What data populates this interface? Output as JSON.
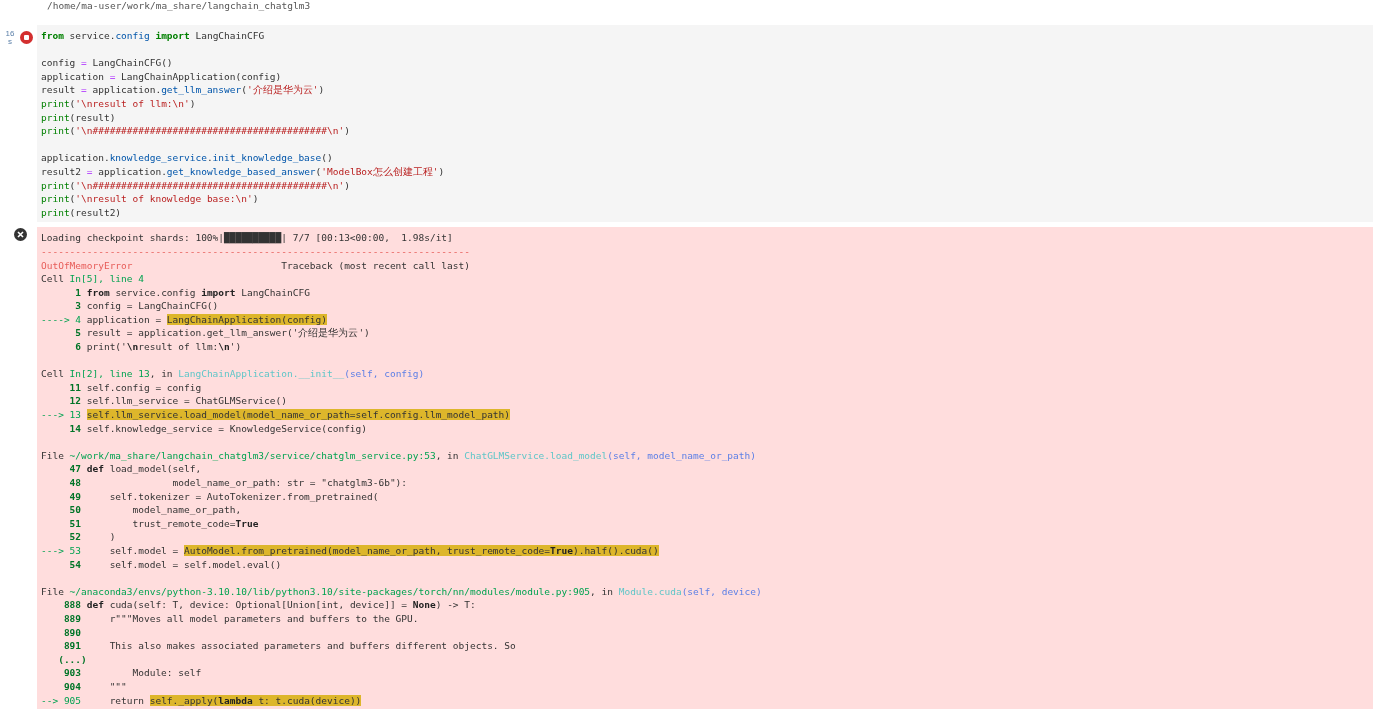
{
  "working_dir": "/home/ma-user/work/ma_share/langchain_chatglm3",
  "cell": {
    "exec_time": {
      "value": "16",
      "unit": "s"
    },
    "running": true,
    "code_blocks": [
      [
        [
          {
            "text": "from",
            "kind": "kw"
          },
          {
            "text": " service.",
            "kind": "p"
          },
          {
            "text": "config",
            "kind": "a"
          },
          {
            "text": " import",
            "kind": "kw"
          },
          {
            "text": " LangChainCFG",
            "kind": "p"
          }
        ]
      ],
      [
        [
          {
            "text": "config ",
            "kind": "p"
          },
          {
            "text": "=",
            "kind": "o"
          },
          {
            "text": " LangChainCFG()",
            "kind": "p"
          }
        ],
        [
          {
            "text": "application ",
            "kind": "p"
          },
          {
            "text": "=",
            "kind": "o"
          },
          {
            "text": " LangChainApplication(config)",
            "kind": "p"
          }
        ],
        [
          {
            "text": "result ",
            "kind": "p"
          },
          {
            "text": "=",
            "kind": "o"
          },
          {
            "text": " application.",
            "kind": "p"
          },
          {
            "text": "get_llm_answer",
            "kind": "a"
          },
          {
            "text": "(",
            "kind": "p"
          },
          {
            "text": "'介绍是华为云'",
            "kind": "s"
          },
          {
            "text": ")",
            "kind": "p"
          }
        ],
        [
          {
            "text": "print",
            "kind": "bi"
          },
          {
            "text": "(",
            "kind": "p"
          },
          {
            "text": "'\\nresult of llm:\\n'",
            "kind": "s"
          },
          {
            "text": ")",
            "kind": "p"
          }
        ],
        [
          {
            "text": "print",
            "kind": "bi"
          },
          {
            "text": "(result)",
            "kind": "p"
          }
        ],
        [
          {
            "text": "print",
            "kind": "bi"
          },
          {
            "text": "(",
            "kind": "p"
          },
          {
            "text": "'\\n#########################################\\n'",
            "kind": "s"
          },
          {
            "text": ")",
            "kind": "p"
          }
        ]
      ],
      [
        [
          {
            "text": "application.",
            "kind": "p"
          },
          {
            "text": "knowledge_service",
            "kind": "a"
          },
          {
            "text": ".",
            "kind": "p"
          },
          {
            "text": "init_knowledge_base",
            "kind": "a"
          },
          {
            "text": "()",
            "kind": "p"
          }
        ],
        [
          {
            "text": "result2 ",
            "kind": "p"
          },
          {
            "text": "=",
            "kind": "o"
          },
          {
            "text": " application.",
            "kind": "p"
          },
          {
            "text": "get_knowledge_based_answer",
            "kind": "a"
          },
          {
            "text": "(",
            "kind": "p"
          },
          {
            "text": "'ModelBox怎么创建工程'",
            "kind": "s"
          },
          {
            "text": ")",
            "kind": "p"
          }
        ],
        [
          {
            "text": "print",
            "kind": "bi"
          },
          {
            "text": "(",
            "kind": "p"
          },
          {
            "text": "'\\n#########################################\\n'",
            "kind": "s"
          },
          {
            "text": ")",
            "kind": "p"
          }
        ],
        [
          {
            "text": "print",
            "kind": "bi"
          },
          {
            "text": "(",
            "kind": "p"
          },
          {
            "text": "'\\nresult of knowledge base:\\n'",
            "kind": "s"
          },
          {
            "text": ")",
            "kind": "p"
          }
        ],
        [
          {
            "text": "print",
            "kind": "bi"
          },
          {
            "text": "(result2)",
            "kind": "p"
          }
        ]
      ]
    ]
  },
  "output": {
    "kind": "error",
    "blocks": [
      [
        [
          {
            "text": "Loading checkpoint shards: 100%|██████████| 7/7 [00:13<00:00,  1.98s/it]",
            "kind": "p"
          }
        ],
        [
          {
            "text": "---------------------------------------------------------------------------",
            "kind": "err"
          }
        ],
        [
          {
            "text": "OutOfMemoryError",
            "kind": "err"
          },
          {
            "text": "                          Traceback (most recent call last)",
            "kind": "p"
          }
        ],
        [
          {
            "text": "Cell ",
            "kind": "p"
          },
          {
            "text": "In[5], line 4",
            "kind": "g"
          }
        ],
        [
          {
            "text": "      1 ",
            "kind": "n"
          },
          {
            "text": "from",
            "kind": "kb"
          },
          {
            "text": " service.config ",
            "kind": "p"
          },
          {
            "text": "import",
            "kind": "kb"
          },
          {
            "text": " LangChainCFG",
            "kind": "p"
          }
        ],
        [
          {
            "text": "      3 ",
            "kind": "n"
          },
          {
            "text": "config = LangChainCFG()",
            "kind": "p"
          }
        ],
        [
          {
            "text": "----> 4 ",
            "kind": "ar"
          },
          {
            "text": "application = ",
            "kind": "p"
          },
          {
            "text": "LangChainApplication(config)",
            "kind": "h"
          }
        ],
        [
          {
            "text": "      5 ",
            "kind": "n"
          },
          {
            "text": "result = application.get_llm_answer('介绍是华为云')",
            "kind": "p"
          }
        ],
        [
          {
            "text": "      6 ",
            "kind": "n"
          },
          {
            "text": "print('",
            "kind": "p"
          },
          {
            "text": "\\n",
            "kind": "kb"
          },
          {
            "text": "result of llm:",
            "kind": "p"
          },
          {
            "text": "\\n",
            "kind": "kb"
          },
          {
            "text": "')",
            "kind": "p"
          }
        ]
      ],
      [
        [
          {
            "text": "Cell ",
            "kind": "p"
          },
          {
            "text": "In[2], line 13",
            "kind": "g"
          },
          {
            "text": ", in ",
            "kind": "p"
          },
          {
            "text": "LangChainApplication.__init__",
            "kind": "c"
          },
          {
            "text": "(self, config)",
            "kind": "b"
          }
        ],
        [
          {
            "text": "     11 ",
            "kind": "n"
          },
          {
            "text": "self.config = config",
            "kind": "p"
          }
        ],
        [
          {
            "text": "     12 ",
            "kind": "n"
          },
          {
            "text": "self.llm_service = ChatGLMService()",
            "kind": "p"
          }
        ],
        [
          {
            "text": "---> 13 ",
            "kind": "ar"
          },
          {
            "text": "self.llm_service.load_model(model_name_or_path=self.config.llm_model_path)",
            "kind": "h"
          }
        ],
        [
          {
            "text": "     14 ",
            "kind": "n"
          },
          {
            "text": "self.knowledge_service = KnowledgeService(config)",
            "kind": "p"
          }
        ]
      ],
      [
        [
          {
            "text": "File ",
            "kind": "p"
          },
          {
            "text": "~/work/ma_share/langchain_chatglm3/service/chatglm_service.py:53",
            "kind": "g"
          },
          {
            "text": ", in ",
            "kind": "p"
          },
          {
            "text": "ChatGLMService.load_model",
            "kind": "c"
          },
          {
            "text": "(self, model_name_or_path)",
            "kind": "b"
          }
        ],
        [
          {
            "text": "     47 ",
            "kind": "n"
          },
          {
            "text": "def",
            "kind": "kb"
          },
          {
            "text": " load_model(self,",
            "kind": "p"
          }
        ],
        [
          {
            "text": "     48 ",
            "kind": "n"
          },
          {
            "text": "               model_name_or_path: str = \"chatglm3-6b\"):",
            "kind": "p"
          }
        ],
        [
          {
            "text": "     49 ",
            "kind": "n"
          },
          {
            "text": "    self.tokenizer = AutoTokenizer.from_pretrained(",
            "kind": "p"
          }
        ],
        [
          {
            "text": "     50 ",
            "kind": "n"
          },
          {
            "text": "        model_name_or_path,",
            "kind": "p"
          }
        ],
        [
          {
            "text": "     51 ",
            "kind": "n"
          },
          {
            "text": "        trust_remote_code=",
            "kind": "p"
          },
          {
            "text": "True",
            "kind": "kb"
          }
        ],
        [
          {
            "text": "     52 ",
            "kind": "n"
          },
          {
            "text": "    )",
            "kind": "p"
          }
        ],
        [
          {
            "text": "---> 53 ",
            "kind": "ar"
          },
          {
            "text": "    self.model = ",
            "kind": "p"
          },
          {
            "text": "AutoModel.from_pretrained(model_name_or_path, trust_remote_code=",
            "kind": "h"
          },
          {
            "text": "True",
            "kind": "hb"
          },
          {
            "text": ").half().cuda()",
            "kind": "h"
          }
        ],
        [
          {
            "text": "     54 ",
            "kind": "n"
          },
          {
            "text": "    self.model = self.model.eval()",
            "kind": "p"
          }
        ]
      ],
      [
        [
          {
            "text": "File ",
            "kind": "p"
          },
          {
            "text": "~/anaconda3/envs/python-3.10.10/lib/python3.10/site-packages/torch/nn/modules/module.py:905",
            "kind": "g"
          },
          {
            "text": ", in ",
            "kind": "p"
          },
          {
            "text": "Module.cuda",
            "kind": "c"
          },
          {
            "text": "(self, device)",
            "kind": "b"
          }
        ],
        [
          {
            "text": "    888 ",
            "kind": "n"
          },
          {
            "text": "def",
            "kind": "kb"
          },
          {
            "text": " cuda(self: T, device: Optional[Union[int, device]] = ",
            "kind": "p"
          },
          {
            "text": "None",
            "kind": "kb"
          },
          {
            "text": ") -> T:",
            "kind": "p"
          }
        ],
        [
          {
            "text": "    889 ",
            "kind": "n"
          },
          {
            "text": "    r\"\"\"Moves all model parameters and buffers to the GPU.",
            "kind": "p"
          }
        ],
        [
          {
            "text": "    890 ",
            "kind": "n"
          }
        ],
        [
          {
            "text": "    891 ",
            "kind": "n"
          },
          {
            "text": "    This also makes associated parameters and buffers different objects. So",
            "kind": "p"
          }
        ],
        [
          {
            "text": "   (...)",
            "kind": "n"
          }
        ],
        [
          {
            "text": "    903 ",
            "kind": "n"
          },
          {
            "text": "        Module: self",
            "kind": "p"
          }
        ],
        [
          {
            "text": "    904 ",
            "kind": "n"
          },
          {
            "text": "    \"\"\"",
            "kind": "p"
          }
        ],
        [
          {
            "text": "--> 905 ",
            "kind": "ar"
          },
          {
            "text": "    return ",
            "kind": "p"
          },
          {
            "text": "self._apply(",
            "kind": "h"
          },
          {
            "text": "lambda",
            "kind": "hb"
          },
          {
            "text": " t: t.cuda(device))",
            "kind": "h"
          }
        ]
      ]
    ]
  }
}
